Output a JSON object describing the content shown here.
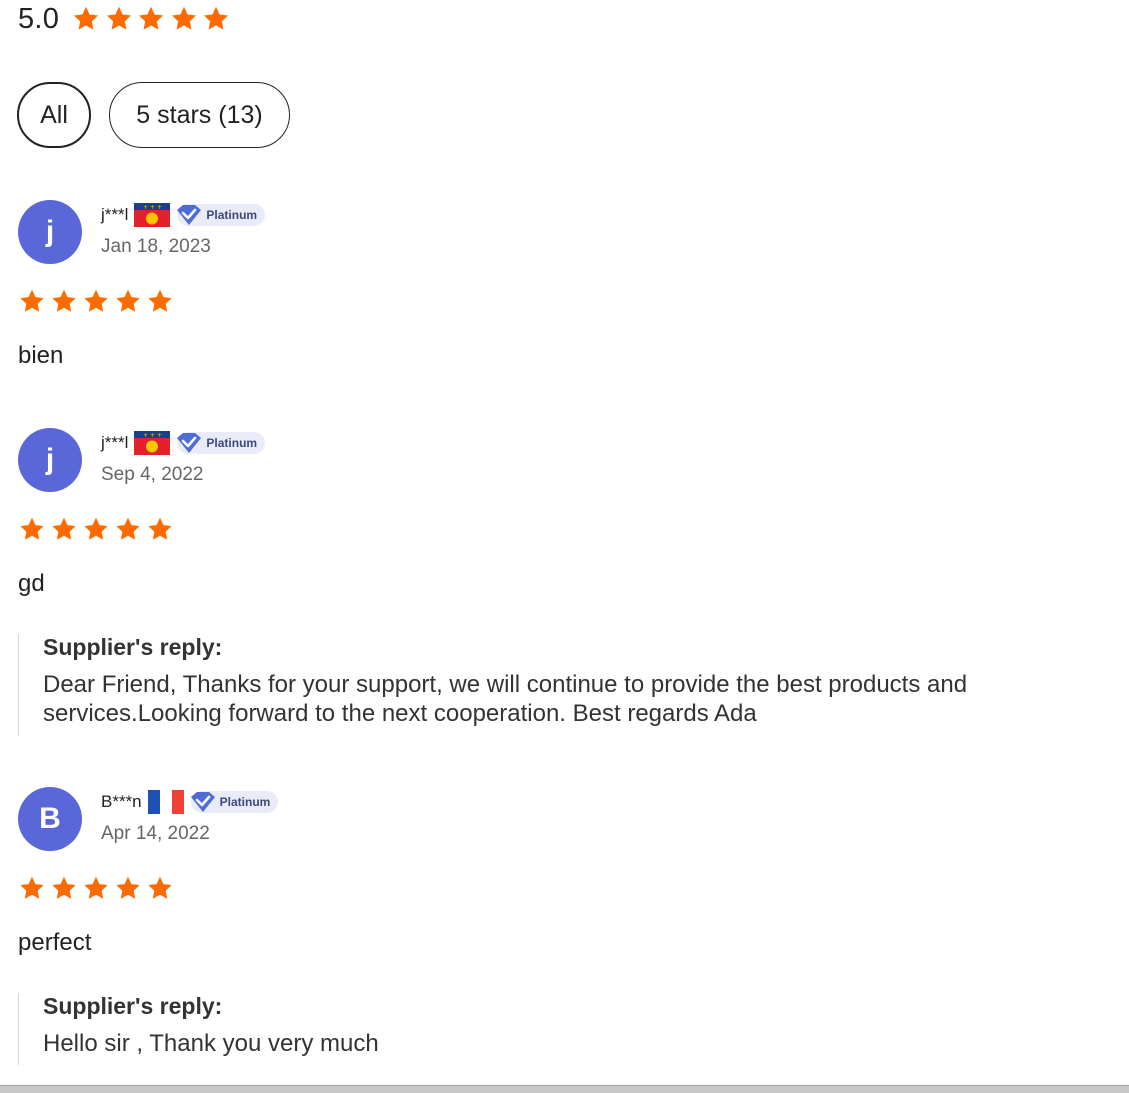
{
  "summary": {
    "score": "5.0",
    "rating": 5,
    "star_color": "#ff6a00"
  },
  "filters": [
    {
      "label": "All",
      "active": true
    },
    {
      "label": "5 stars (13)",
      "active": false
    }
  ],
  "reviews": [
    {
      "avatar_letter": "j",
      "name": "j***l",
      "flag": "guadeloupe-flag",
      "badge": "Platinum",
      "date": "Jan 18, 2023",
      "rating": 5,
      "comment": "bien"
    },
    {
      "avatar_letter": "j",
      "name": "j***l",
      "flag": "guadeloupe-flag",
      "badge": "Platinum",
      "date": "Sep 4, 2022",
      "rating": 5,
      "comment": "gd",
      "reply": {
        "title": "Supplier's reply:",
        "text": "Dear Friend, Thanks for your support, we will continue to provide the best products and services.Looking forward to the next cooperation. Best regards Ada"
      }
    },
    {
      "avatar_letter": "B",
      "name": "B***n",
      "flag": "france-flag",
      "badge": "Platinum",
      "date": "Apr 14, 2022",
      "rating": 5,
      "comment": "perfect",
      "reply": {
        "title": "Supplier's reply:",
        "text": "Hello sir , Thank you very much"
      }
    }
  ],
  "colors": {
    "avatar": "#5a67d8",
    "badge_bg": "#e9ecf8",
    "badge_icon": "#4f6bd8"
  }
}
